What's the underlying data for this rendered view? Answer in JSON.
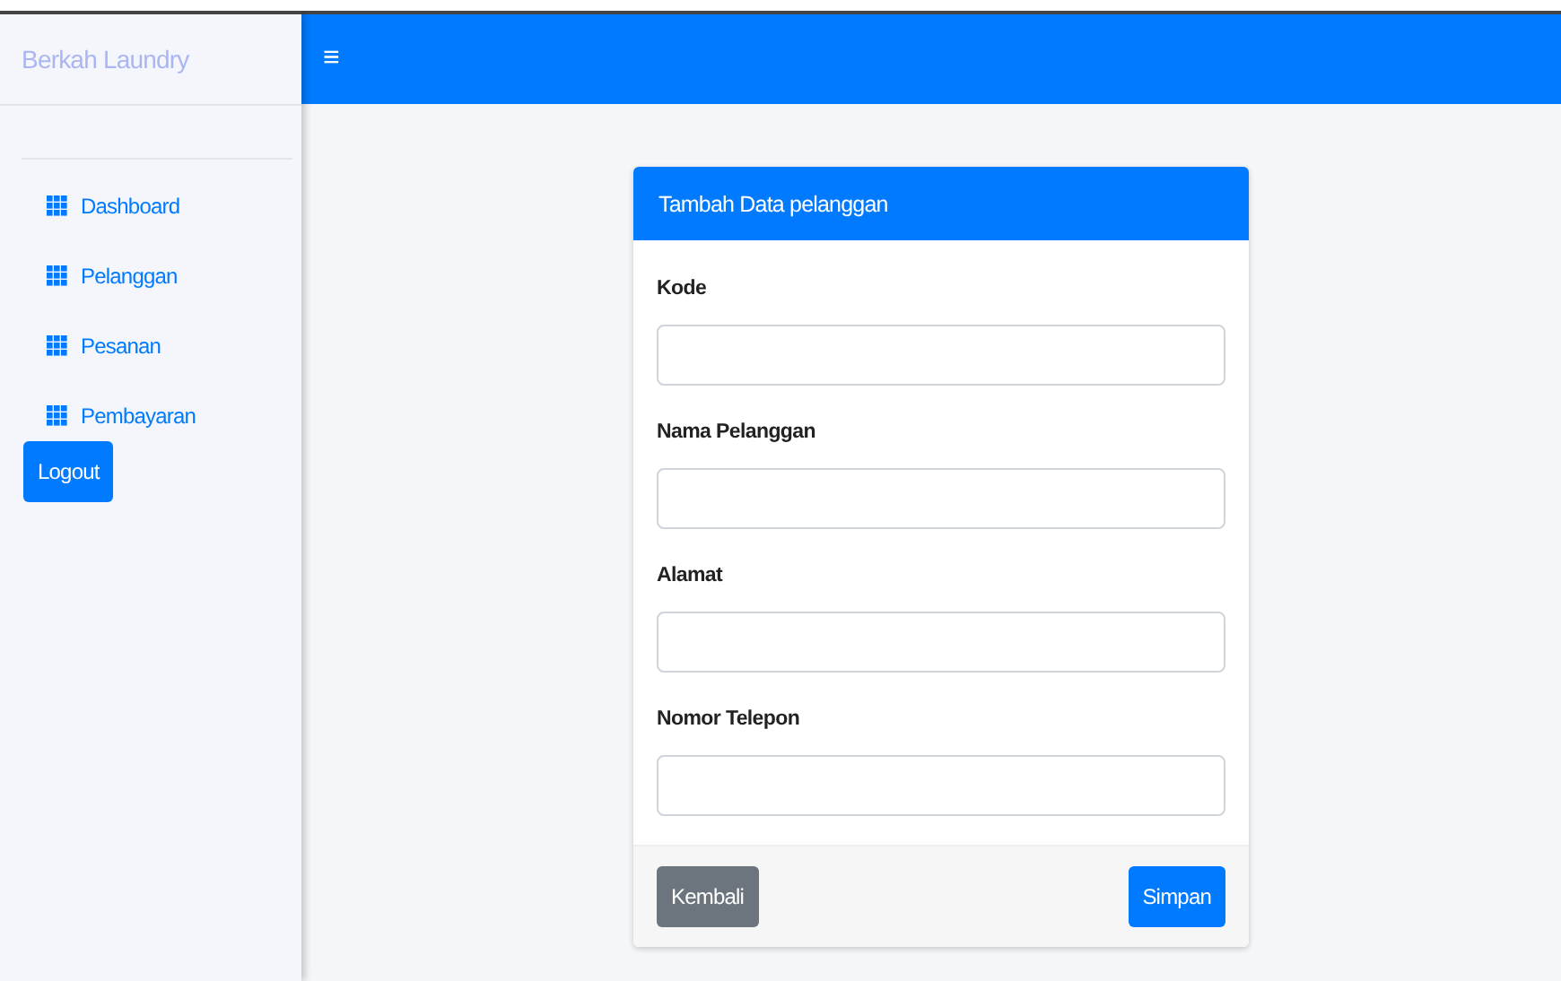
{
  "sidebar": {
    "brand": "Berkah Laundry",
    "items": [
      {
        "label": "Dashboard"
      },
      {
        "label": "Pelanggan"
      },
      {
        "label": "Pesanan"
      },
      {
        "label": "Pembayaran"
      }
    ],
    "logout": "Logout"
  },
  "topbar": {
    "menu_icon": "≡"
  },
  "form": {
    "title": "Tambah Data pelanggan",
    "fields": [
      {
        "label": "Kode"
      },
      {
        "label": "Nama Pelanggan"
      },
      {
        "label": "Alamat"
      },
      {
        "label": "Nomor Telepon"
      }
    ],
    "buttons": {
      "back": "Kembali",
      "save": "Simpan"
    }
  }
}
